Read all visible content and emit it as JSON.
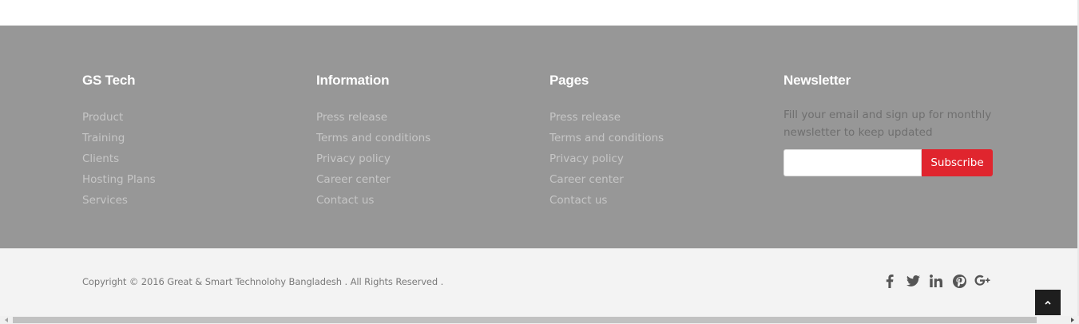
{
  "columns": [
    {
      "title": "GS Tech",
      "links": [
        "Product",
        "Training",
        "Clients",
        "Hosting Plans",
        "Services"
      ]
    },
    {
      "title": "Information",
      "links": [
        "Press release",
        "Terms and conditions",
        "Privacy policy",
        "Career center",
        "Contact us"
      ]
    },
    {
      "title": "Pages",
      "links": [
        "Press release",
        "Terms and conditions",
        "Privacy policy",
        "Career center",
        "Contact us"
      ]
    }
  ],
  "newsletter": {
    "title": "Newsletter",
    "text": "Fill your email and sign up for monthly newsletter to keep updated",
    "email_value": "",
    "subscribe_label": "Subscribe"
  },
  "footer": {
    "copyright": "Copyright © 2016 Great & Smart Technolohy Bangladesh . All Rights Reserved .",
    "social": [
      "facebook-icon",
      "twitter-icon",
      "linkedin-icon",
      "pinterest-icon",
      "google-plus-icon"
    ]
  },
  "colors": {
    "footer_bg": "#979797",
    "bottom_bg": "#f3f3f3",
    "accent": "#e0252e",
    "back_to_top_bg": "#1e1e1e"
  }
}
